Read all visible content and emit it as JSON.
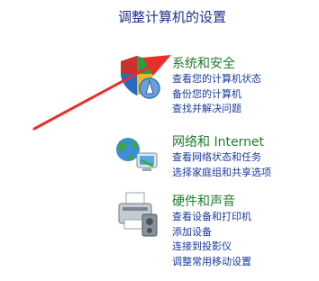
{
  "page_title": "调整计算机的设置",
  "categories": [
    {
      "title": "系统和安全",
      "icon": "shield-flag-icon",
      "links": [
        "查看您的计算机状态",
        "备份您的计算机",
        "查找并解决问题"
      ]
    },
    {
      "title": "网络和 Internet",
      "icon": "network-globe-icon",
      "links": [
        "查看网络状态和任务",
        "选择家庭组和共享选项"
      ]
    },
    {
      "title": "硬件和声音",
      "icon": "printer-icon",
      "links": [
        "查看设备和打印机",
        "添加设备",
        "连接到投影仪",
        "调整常用移动设置"
      ]
    }
  ],
  "annotation": {
    "icon": "red-arrow-icon",
    "color": "#e8302a"
  },
  "colors": {
    "title": "#1e3287",
    "category": "#1e7d2a",
    "link": "#1a3a9c"
  }
}
